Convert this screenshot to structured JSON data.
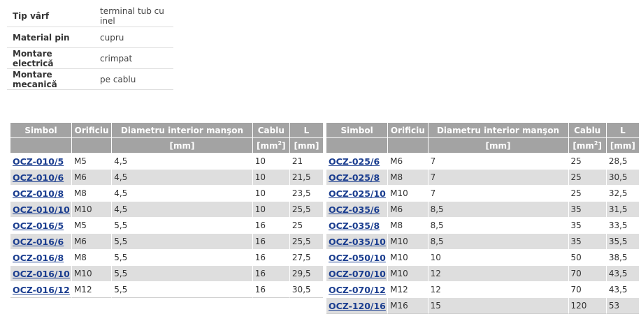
{
  "properties": [
    {
      "key": "Tip vârf",
      "value": "terminal tub cu inel"
    },
    {
      "key": "Material pin",
      "value": "cupru"
    },
    {
      "key": "Montare electrică",
      "value": "crimpat"
    },
    {
      "key": "Montare mecanică",
      "value": "pe cablu"
    }
  ],
  "headers": {
    "simbol": "Simbol",
    "orificiu": "Orificiu",
    "diametru": "Diametru interior manşon",
    "cablu": "Cablu",
    "l": "L",
    "unit_mm": "[mm]",
    "unit_mm2_prefix": "[mm",
    "unit_mm2_sup": "2",
    "unit_mm2_suffix": "]",
    "unit_l": "[mm]"
  },
  "left_rows": [
    {
      "simbol": "OCZ-010/5",
      "orificiu": "M5",
      "diametru": "4,5",
      "cablu": "10",
      "l": "21"
    },
    {
      "simbol": "OCZ-010/6",
      "orificiu": "M6",
      "diametru": "4,5",
      "cablu": "10",
      "l": "21,5"
    },
    {
      "simbol": "OCZ-010/8",
      "orificiu": "M8",
      "diametru": "4,5",
      "cablu": "10",
      "l": "23,5"
    },
    {
      "simbol": "OCZ-010/10",
      "orificiu": "M10",
      "diametru": "4,5",
      "cablu": "10",
      "l": "25,5"
    },
    {
      "simbol": "OCZ-016/5",
      "orificiu": "M5",
      "diametru": "5,5",
      "cablu": "16",
      "l": "25"
    },
    {
      "simbol": "OCZ-016/6",
      "orificiu": "M6",
      "diametru": "5,5",
      "cablu": "16",
      "l": "25,5"
    },
    {
      "simbol": "OCZ-016/8",
      "orificiu": "M8",
      "diametru": "5,5",
      "cablu": "16",
      "l": "27,5"
    },
    {
      "simbol": "OCZ-016/10",
      "orificiu": "M10",
      "diametru": "5,5",
      "cablu": "16",
      "l": "29,5"
    },
    {
      "simbol": "OCZ-016/12",
      "orificiu": "M12",
      "diametru": "5,5",
      "cablu": "16",
      "l": "30,5"
    }
  ],
  "right_rows": [
    {
      "simbol": "OCZ-025/6",
      "orificiu": "M6",
      "diametru": "7",
      "cablu": "25",
      "l": "28,5"
    },
    {
      "simbol": "OCZ-025/8",
      "orificiu": "M8",
      "diametru": "7",
      "cablu": "25",
      "l": "30,5"
    },
    {
      "simbol": "OCZ-025/10",
      "orificiu": "M10",
      "diametru": "7",
      "cablu": "25",
      "l": "32,5"
    },
    {
      "simbol": "OCZ-035/6",
      "orificiu": "M6",
      "diametru": "8,5",
      "cablu": "35",
      "l": "31,5"
    },
    {
      "simbol": "OCZ-035/8",
      "orificiu": "M8",
      "diametru": "8,5",
      "cablu": "35",
      "l": "33,5"
    },
    {
      "simbol": "OCZ-035/10",
      "orificiu": "M10",
      "diametru": "8,5",
      "cablu": "35",
      "l": "35,5"
    },
    {
      "simbol": "OCZ-050/10",
      "orificiu": "M10",
      "diametru": "10",
      "cablu": "50",
      "l": "38,5"
    },
    {
      "simbol": "OCZ-070/10",
      "orificiu": "M10",
      "diametru": "12",
      "cablu": "70",
      "l": "43,5"
    },
    {
      "simbol": "OCZ-070/12",
      "orificiu": "M12",
      "diametru": "12",
      "cablu": "70",
      "l": "43,5"
    },
    {
      "simbol": "OCZ-120/16",
      "orificiu": "M16",
      "diametru": "15",
      "cablu": "120",
      "l": "53"
    }
  ],
  "colors": {
    "header_bg": "#a3a3a3",
    "zebra": "#dedede",
    "link": "#1a3d8f"
  }
}
